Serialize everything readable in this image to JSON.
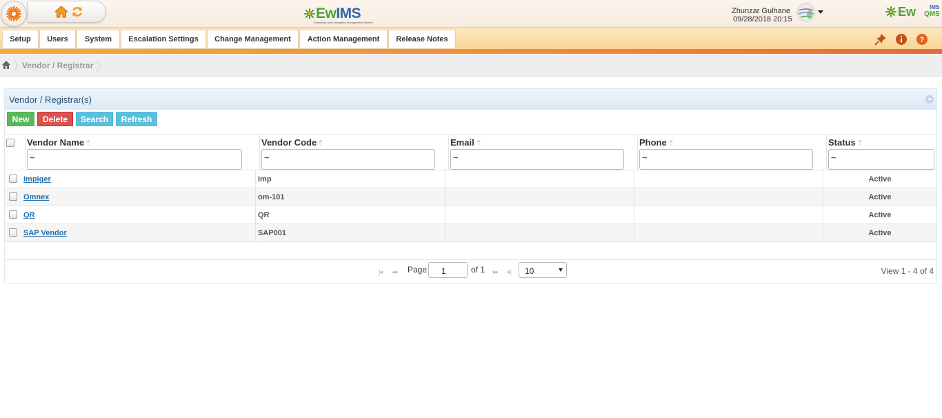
{
  "header": {
    "brand_center": {
      "prefix": "Ew",
      "suffix": "IMS",
      "tagline": "Enterprise-wide Integrated Management System"
    },
    "user_name": "Zhunzar Gulhane",
    "user_datetime": "09/28/2018 20:15",
    "brand_right": {
      "prefix": "Ew",
      "ims": "IMS",
      "qms": "QMS"
    }
  },
  "menu": {
    "items": [
      {
        "label": "Setup"
      },
      {
        "label": "Users"
      },
      {
        "label": "System"
      },
      {
        "label": "Escalation Settings"
      },
      {
        "label": "Change Management"
      },
      {
        "label": "Action Management"
      },
      {
        "label": "Release Notes"
      }
    ]
  },
  "breadcrumb": {
    "current": "Vendor / Registrar"
  },
  "panel": {
    "title": "Vendor / Registrar(s)",
    "buttons": {
      "new": "New",
      "delete": "Delete",
      "search": "Search",
      "refresh": "Refresh"
    }
  },
  "grid": {
    "columns": [
      {
        "label": "Vendor Name",
        "filter": "~"
      },
      {
        "label": "Vendor Code",
        "filter": "~"
      },
      {
        "label": "Email",
        "filter": "~"
      },
      {
        "label": "Phone",
        "filter": "~"
      },
      {
        "label": "Status",
        "filter": "~"
      }
    ],
    "rows": [
      {
        "name": "Impiger",
        "code": "Imp",
        "email": "",
        "phone": "",
        "status": "Active"
      },
      {
        "name": "Omnex",
        "code": "om-101",
        "email": "",
        "phone": "",
        "status": "Active"
      },
      {
        "name": "QR",
        "code": "QR",
        "email": "",
        "phone": "",
        "status": "Active"
      },
      {
        "name": "SAP Vendor",
        "code": "SAP001",
        "email": "",
        "phone": "",
        "status": "Active"
      }
    ]
  },
  "pager": {
    "page_label": "Page",
    "page_value": "1",
    "of_label": "of 1",
    "page_size": "10",
    "view_text": "View 1 - 4 of 4"
  },
  "colors": {
    "accent_orange": "#f08a3a",
    "link_blue": "#1f6fb0",
    "new_green": "#5cb85c",
    "delete_red": "#d9534f",
    "search_blue": "#5bc0de"
  }
}
